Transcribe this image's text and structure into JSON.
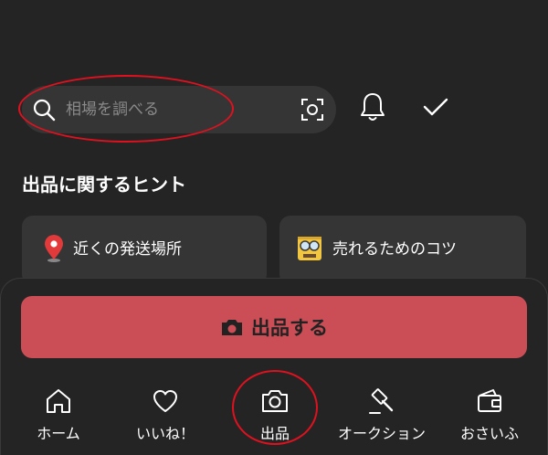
{
  "search": {
    "placeholder": "相場を調べる",
    "icon": "search-icon",
    "scan_icon": "scan-icon"
  },
  "header_icons": {
    "notifications": "bell-icon",
    "todo": "check-icon"
  },
  "hints": {
    "title": "出品に関するヒント",
    "cards": [
      {
        "label": "近くの発送場所",
        "icon": "location-pin-icon"
      },
      {
        "label": "売れるためのコツ",
        "icon": "tips-character-icon"
      }
    ]
  },
  "sell_button": {
    "label": "出品する",
    "icon": "camera-icon"
  },
  "bottom_nav": {
    "items": [
      {
        "label": "ホーム",
        "icon": "home-icon"
      },
      {
        "label": "いいね！",
        "icon": "heart-icon"
      },
      {
        "label": "出品",
        "icon": "camera-icon"
      },
      {
        "label": "オークション",
        "icon": "gavel-icon"
      },
      {
        "label": "おさいふ",
        "icon": "wallet-icon"
      }
    ]
  },
  "colors": {
    "background": "#242424",
    "surface": "#353535",
    "accent": "#cb4e56",
    "annotation": "#e0111f",
    "text": "#ffffff",
    "placeholder": "#8a8a8a"
  }
}
